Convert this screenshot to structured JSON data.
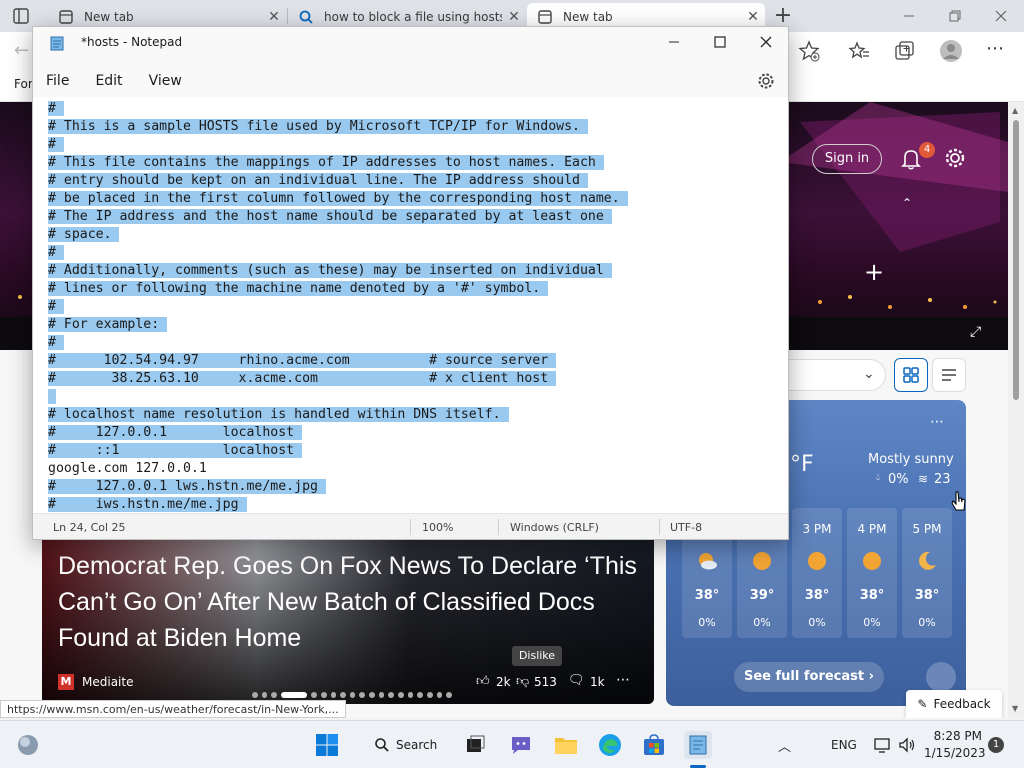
{
  "browser": {
    "tabs": [
      {
        "title": "New tab",
        "icon": "newtab-icon"
      },
      {
        "title": "how to block a file using hosts -",
        "icon": "search-icon"
      },
      {
        "title": "New tab",
        "icon": "newtab-icon"
      }
    ],
    "new_tab": "+",
    "bookmark_partial": "For",
    "status_url": "https://www.msn.com/en-us/weather/forecast/in-New-York,..."
  },
  "msn": {
    "sign_in": "Sign in",
    "notif_count": "4",
    "headline": "Democrat Rep. Goes On Fox News To Declare ‘This Can’t Go On’ After New Batch of Classified Docs Found at Biden Home",
    "source": "Mediaite",
    "likes": "2k",
    "dislikes": "513",
    "comments": "1k",
    "tooltip": "Dislike",
    "feedback": "Feedback",
    "weather": {
      "unit": "°F",
      "condition": "Mostly sunny",
      "precip": "0%",
      "wind": "23",
      "hours": [
        {
          "time": "",
          "temp": "38°",
          "precip": "0%",
          "icon": "partly-cloudy-icon"
        },
        {
          "time": "",
          "temp": "39°",
          "precip": "0%",
          "icon": "sun-icon"
        },
        {
          "time": "3 PM",
          "temp": "38°",
          "precip": "0%",
          "icon": "sun-icon"
        },
        {
          "time": "4 PM",
          "temp": "38°",
          "precip": "0%",
          "icon": "sun-icon"
        },
        {
          "time": "5 PM",
          "temp": "38°",
          "precip": "0%",
          "icon": "moon-icon"
        }
      ],
      "see_full": "See full forecast"
    }
  },
  "notepad": {
    "title": "*hosts - Notepad",
    "menu": [
      "File",
      "Edit",
      "View"
    ],
    "lines": [
      {
        "text": "#",
        "selected": true
      },
      {
        "text": "# This is a sample HOSTS file used by Microsoft TCP/IP for Windows.",
        "selected": true
      },
      {
        "text": "#",
        "selected": true
      },
      {
        "text": "# This file contains the mappings of IP addresses to host names. Each",
        "selected": true
      },
      {
        "text": "# entry should be kept on an individual line. The IP address should",
        "selected": true
      },
      {
        "text": "# be placed in the first column followed by the corresponding host name.",
        "selected": true
      },
      {
        "text": "# The IP address and the host name should be separated by at least one",
        "selected": true
      },
      {
        "text": "# space.",
        "selected": true
      },
      {
        "text": "#",
        "selected": true
      },
      {
        "text": "# Additionally, comments (such as these) may be inserted on individual",
        "selected": true
      },
      {
        "text": "# lines or following the machine name denoted by a '#' symbol.",
        "selected": true
      },
      {
        "text": "#",
        "selected": true
      },
      {
        "text": "# For example:",
        "selected": true
      },
      {
        "text": "#",
        "selected": true
      },
      {
        "text": "#      102.54.94.97     rhino.acme.com          # source server",
        "selected": true
      },
      {
        "text": "#       38.25.63.10     x.acme.com              # x client host",
        "selected": true
      },
      {
        "text": "",
        "selected": true
      },
      {
        "text": "# localhost name resolution is handled within DNS itself.",
        "selected": true
      },
      {
        "text": "#     127.0.0.1       localhost",
        "selected": true
      },
      {
        "text": "#     ::1             localhost",
        "selected": true
      },
      {
        "text": "google.com 127.0.0.1",
        "selected": false
      },
      {
        "text": "#     127.0.0.1 lws.hstn.me/me.jpg",
        "selected": true
      },
      {
        "text": "#     iws.hstn.me/me.jpg",
        "selected": true
      }
    ],
    "status": {
      "position": "Ln 24, Col 25",
      "zoom": "100%",
      "line_ending": "Windows (CRLF)",
      "encoding": "UTF-8"
    }
  },
  "taskbar": {
    "search": "Search",
    "lang": "ENG",
    "time": "8:28 PM",
    "date": "1/15/2023",
    "notif": "1"
  },
  "colors": {
    "selection": "#99c9ef",
    "weather_card": "#4a72b3",
    "edge_accent": "#0a66c2"
  }
}
